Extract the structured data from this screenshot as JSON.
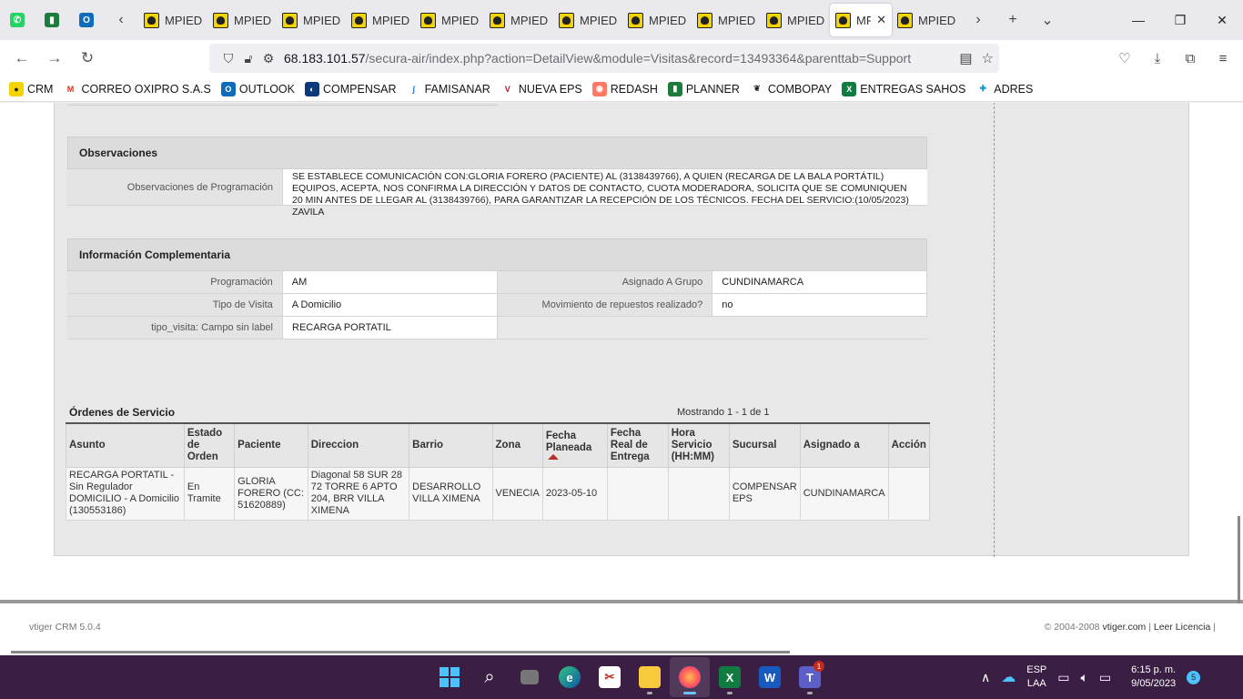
{
  "tabs": {
    "pinned": [
      {
        "name": "whatsapp",
        "glyph": "✆",
        "color": "#25d366"
      },
      {
        "name": "planner",
        "glyph": "▮",
        "color": "#1d7c3c"
      },
      {
        "name": "outlook",
        "glyph": "O",
        "color": "#0f6cbd"
      }
    ],
    "items": [
      {
        "title": "MPIED"
      },
      {
        "title": "MPIED"
      },
      {
        "title": "MPIED"
      },
      {
        "title": "MPIED"
      },
      {
        "title": "MPIED"
      },
      {
        "title": "MPIED"
      },
      {
        "title": "MPIED"
      },
      {
        "title": "MPIED"
      },
      {
        "title": "MPIED"
      },
      {
        "title": "MPIED"
      },
      {
        "title": "MP",
        "active": true
      },
      {
        "title": "MPIED"
      }
    ]
  },
  "address": {
    "host": "68.183.101.57",
    "path": "/secura-air/index.php?action=DetailView&module=Visitas&record=13493364&parenttab=Support"
  },
  "bookmarks": [
    {
      "label": "CRM",
      "icon": "crm-icon",
      "color": "#f4d400",
      "text": "#222",
      "glyph": "●"
    },
    {
      "label": "CORREO OXIPRO S.A.S",
      "icon": "gmail-icon",
      "color": "#ffffff",
      "text": "#d93025",
      "glyph": "M"
    },
    {
      "label": "OUTLOOK",
      "icon": "outlook-icon",
      "color": "#0f6cbd",
      "text": "#fff",
      "glyph": "O"
    },
    {
      "label": "COMPENSAR",
      "icon": "compensar-icon",
      "color": "#0b3a7a",
      "text": "#fff",
      "glyph": "◐"
    },
    {
      "label": "FAMISANAR",
      "icon": "famisanar-icon",
      "color": "#ffffff",
      "text": "#2b7bd6",
      "glyph": "ʃ"
    },
    {
      "label": "NUEVA EPS",
      "icon": "nueva-eps-icon",
      "color": "#ffffff",
      "text": "#b0162d",
      "glyph": "V"
    },
    {
      "label": "REDASH",
      "icon": "redash-icon",
      "color": "#ff7964",
      "text": "#fff",
      "glyph": "◉"
    },
    {
      "label": "PLANNER",
      "icon": "planner-icon",
      "color": "#1d7c3c",
      "text": "#fff",
      "glyph": "▮"
    },
    {
      "label": "COMBOPAY",
      "icon": "combopay-icon",
      "color": "#ffffff",
      "text": "#222",
      "glyph": "❦"
    },
    {
      "label": "ENTREGAS SAHOS",
      "icon": "excel-icon",
      "color": "#107c41",
      "text": "#fff",
      "glyph": "X"
    },
    {
      "label": "ADRES",
      "icon": "adres-icon",
      "color": "#ffffff",
      "text": "#0a9bd6",
      "glyph": "✚"
    }
  ],
  "observaciones": {
    "title": "Observaciones",
    "label": "Observaciones de Programación",
    "value": "   SE ESTABLECE COMUNICACIÓN CON:GLORIA FORERO (PACIENTE) AL (3138439766), A QUIEN (RECARGA DE LA BALA PORTÁTIL) EQUIPOS, ACEPTA, NOS CONFIRMA LA DIRECCIÓN Y DATOS DE CONTACTO, CUOTA MODERADORA, SOLICITA QUE SE COMUNIQUEN 20 MIN ANTES DE LLEGAR AL (3138439766), PARA GARANTIZAR LA RECEPCIÓN DE LOS TÉCNICOS. FECHA DEL SERVICIO:(10/05/2023) ZAVILA"
  },
  "info": {
    "title": "Información Complementaria",
    "rows": [
      {
        "l1": "Programación",
        "v1": "AM",
        "l2": "Asignado A Grupo",
        "v2": "CUNDINAMARCA"
      },
      {
        "l1": "Tipo de Visita",
        "v1": "A Domicilio",
        "l2": "Movimiento de repuestos realizado?",
        "v2": " no"
      },
      {
        "l1": "tipo_visita: Campo sin label",
        "v1": "RECARGA PORTATIL"
      }
    ]
  },
  "ordenes": {
    "title": "Órdenes de Servicio",
    "count": "Mostrando 1 - 1 de 1",
    "headers": [
      "Asunto",
      "Estado de Orden",
      "Paciente",
      "Direccion",
      "Barrio",
      "Zona",
      "Fecha Planeada",
      "Fecha Real de Entrega",
      "Hora Servicio (HH:MM)",
      "Sucursal",
      "Asignado a",
      "Acción"
    ],
    "rows": [
      [
        "RECARGA PORTATIL - Sin Regulador DOMICILIO - A Domicilio (130553186)",
        "En Tramite",
        "GLORIA FORERO (CC: 51620889)",
        "Diagonal 58 SUR 28 72 TORRE 6 APTO 204, BRR VILLA XIMENA",
        "DESARROLLO VILLA XIMENA",
        "VENECIA",
        "2023-05-10",
        "",
        "",
        "COMPENSAR EPS",
        "CUNDINAMARCA",
        ""
      ]
    ]
  },
  "footer": {
    "left": "vtiger CRM 5.0.4",
    "copyright": "© 2004-2008 ",
    "site": "vtiger.com",
    "sep": " | ",
    "license": "Leer Licencia",
    "tail": " |"
  },
  "taskbar": {
    "lang1": "ESP",
    "lang2": "LAA",
    "time": "6:15 p. m.",
    "date": "9/05/2023",
    "notif": "5",
    "teams_badge": "1"
  }
}
